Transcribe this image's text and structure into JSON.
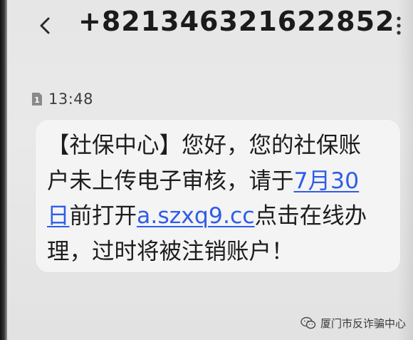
{
  "header": {
    "back_icon": "chevron-left-icon",
    "contact_number": "+821346321622852",
    "more_icon": "more-vertical-icon"
  },
  "message": {
    "sim_icon": "sim-1-icon",
    "time": "13:48",
    "lines": [
      [
        {
          "text": "【社保中心】您好，您的社保账"
        }
      ],
      [
        {
          "text": "户未上传电子审核，请于"
        },
        {
          "text": "7月30",
          "link": true
        }
      ],
      [
        {
          "text": "日",
          "link": true
        },
        {
          "text": "前打开"
        },
        {
          "text": "a.szxq9.cc",
          "link": true
        },
        {
          "text": "点击在线办"
        }
      ],
      [
        {
          "text": "理，过时将被注销账户！"
        }
      ]
    ]
  },
  "watermark": {
    "icon": "wechat-icon",
    "text": "厦门市反诈骗中心"
  },
  "colors": {
    "link": "#2f5de8",
    "text": "#1d1d1d",
    "bubble": "#f4f4f4",
    "background": "#e6e6e6"
  }
}
